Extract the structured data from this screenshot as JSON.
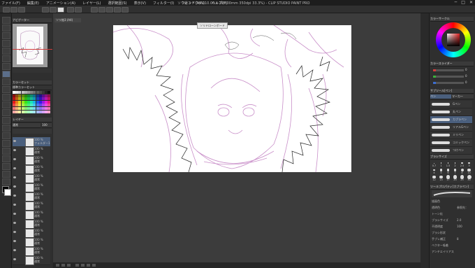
{
  "window": {
    "title": "ソリ絵３ * (A4 210.00 x 297.00mm 350dpi 33.3%) - CLIP STUDIO PAINT PRO",
    "controls": [
      "─",
      "□",
      "✕"
    ]
  },
  "menu": [
    "ファイル(F)",
    "編集(E)",
    "アニメーション(A)",
    "レイヤー(L)",
    "選択範囲(S)",
    "表示(V)",
    "フィルター(I)",
    "ウィンドウ(W)",
    "ヘルプ(H)"
  ],
  "left_panel": {
    "navigator_tab": "ナビゲーター",
    "color_set_tab": "カラーセット",
    "color_set_name": "標準カラーセット",
    "layer_tab": "レイヤー",
    "blend_mode": "通常",
    "opacity": "100",
    "layers": [
      {
        "label": "100 %",
        "name": "フォルダー1",
        "selected": true
      },
      {
        "label": "100 %",
        "name": "通常"
      },
      {
        "label": "100 %",
        "name": "通常"
      },
      {
        "label": "100 %",
        "name": "通常"
      },
      {
        "label": "100 %",
        "name": "通常"
      },
      {
        "label": "100 %",
        "name": "通常"
      },
      {
        "label": "100 %",
        "name": "通常"
      },
      {
        "label": "100 %",
        "name": "通常"
      },
      {
        "label": "100 %",
        "name": "通常"
      },
      {
        "label": "100 %",
        "name": "通常"
      },
      {
        "label": "100 %",
        "name": "通常"
      },
      {
        "label": "100 %",
        "name": "通常"
      },
      {
        "label": "100 %",
        "name": "通常"
      },
      {
        "label": "100 %",
        "name": "通常"
      }
    ]
  },
  "canvas": {
    "tab_label": "ソリ絵3 (A4)",
    "float_button": "ソリドローンボード"
  },
  "right_panel": {
    "color_wheel_tab": "カラーサークル",
    "color_slider_tab": "カラースライダー",
    "slider_values": [
      "0",
      "0",
      "0"
    ],
    "sub_tool_tab": "サブツール[ペン]",
    "sub_tool_groups": [
      "ペン",
      "マーカー"
    ],
    "brushes": [
      {
        "name": "Gペン",
        "selected": false
      },
      {
        "name": "丸ペン",
        "selected": false
      },
      {
        "name": "カブラペン",
        "selected": true
      },
      {
        "name": "リアルGペン",
        "selected": false
      },
      {
        "name": "ミリペン",
        "selected": false
      },
      {
        "name": "コミックペン",
        "selected": false
      },
      {
        "name": "つけペン",
        "selected": false
      }
    ],
    "brush_size_tab": "ブラシサイズ",
    "brush_sizes": [
      "0.7",
      "1",
      "1.5",
      "2",
      "2.5",
      "3",
      "4",
      "5",
      "6",
      "7",
      "8",
      "10",
      "12",
      "15",
      "17",
      "20",
      "25",
      "30"
    ],
    "tool_property_tab": "ツールプロパティ[カブラペン]",
    "properties": [
      {
        "label": "描画色"
      },
      {
        "label": "透明色",
        "value": "参照先："
      },
      {
        "label": "トーン化"
      },
      {
        "label": "ブラシサイズ",
        "value": "2.0"
      },
      {
        "label": "不透明度",
        "value": "100"
      },
      {
        "label": "ブラシ形状"
      },
      {
        "label": "手ブレ補正",
        "value": "8"
      },
      {
        "label": "ベクター吸着"
      },
      {
        "label": "アンチエイリアス"
      }
    ]
  },
  "colors": {
    "canvas_line": "#c98fc9",
    "canvas_ink": "#222222",
    "selected": "#4a5f7d",
    "nav_indicator": "#d23c3c"
  }
}
